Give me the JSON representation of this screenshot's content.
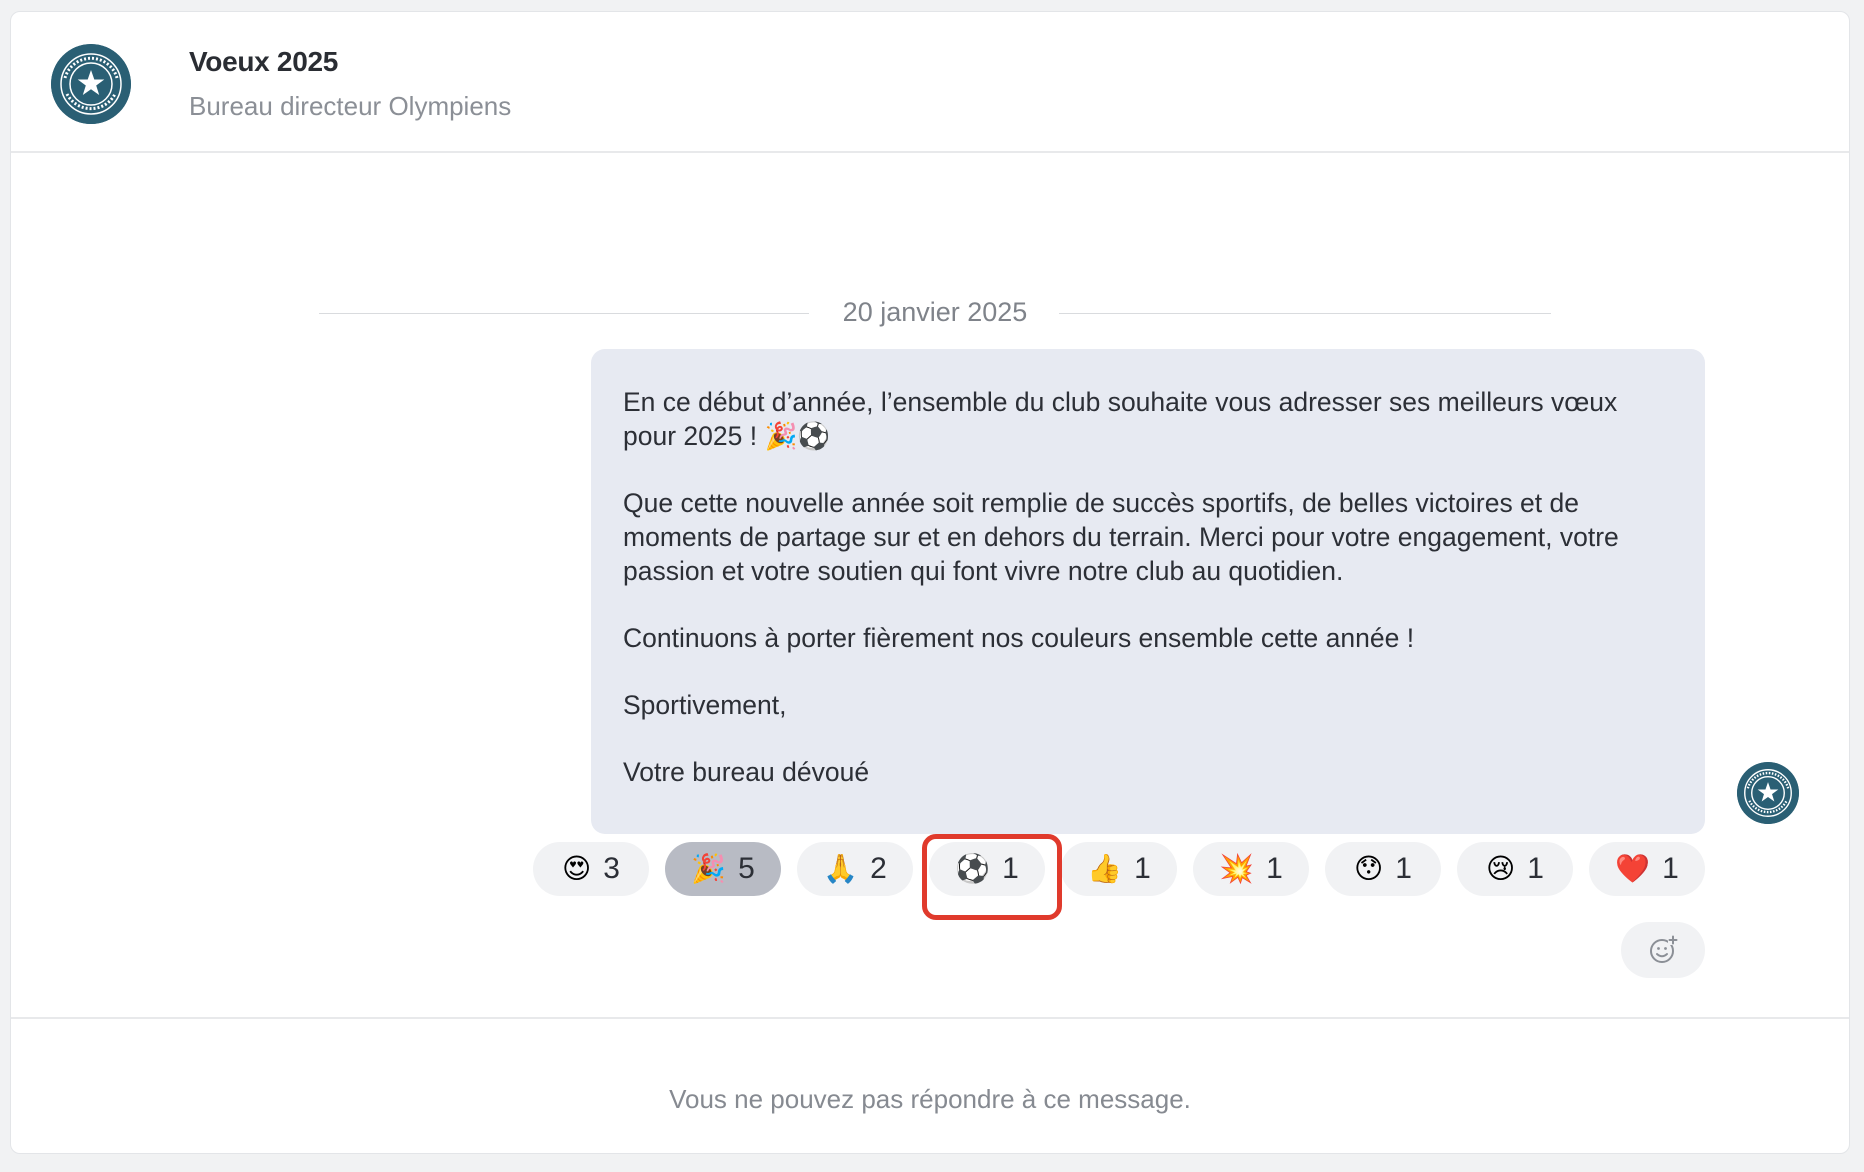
{
  "header": {
    "title": "Voeux 2025",
    "subtitle": "Bureau directeur Olympiens",
    "logo_text": "OLYMPIENS"
  },
  "date_separator": "20 janvier 2025",
  "message": {
    "paragraphs": [
      "En ce début d’année, l’ensemble du club souhaite vous adresser ses meilleurs vœux pour 2025 ! 🎉⚽",
      "Que cette nouvelle année soit remplie de succès sportifs, de belles victoires et de moments de partage sur et en dehors du terrain. Merci pour votre engagement, votre passion et votre soutien qui font vivre notre club au quotidien.",
      "Continuons à porter fièrement nos couleurs ensemble cette année !",
      "Sportivement,",
      "Votre bureau dévoué"
    ]
  },
  "reactions": [
    {
      "emoji": "😍",
      "count": "3",
      "active": false
    },
    {
      "emoji": "🎉",
      "count": "5",
      "active": true
    },
    {
      "emoji": "🙏",
      "count": "2",
      "active": false
    },
    {
      "emoji": "⚽",
      "count": "1",
      "active": false
    },
    {
      "emoji": "👍",
      "count": "1",
      "active": false
    },
    {
      "emoji": "💥",
      "count": "1",
      "active": false
    },
    {
      "emoji": "😯",
      "count": "1",
      "active": false
    },
    {
      "emoji": "😢",
      "count": "1",
      "active": false
    },
    {
      "emoji": "❤️",
      "count": "1",
      "active": false
    }
  ],
  "add_reaction_icon": "add-emoji-icon",
  "footer_note": "Vous ne pouvez pas répondre à ce message.",
  "colors": {
    "bubble": "#e7eaf2",
    "active_chip": "#b8bbc4",
    "chip": "#f1f2f4",
    "highlight": "#e03a2c",
    "logo": "#2a5f74"
  }
}
